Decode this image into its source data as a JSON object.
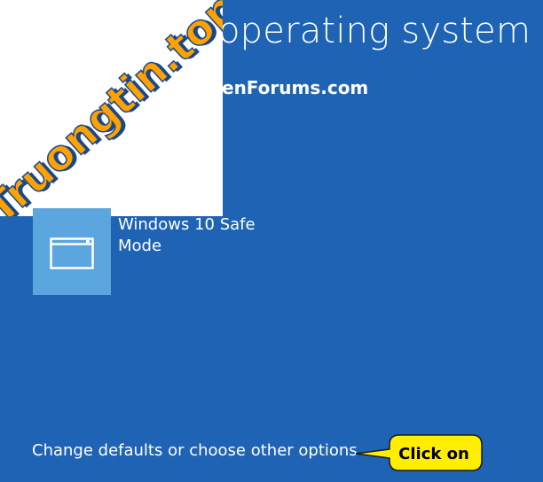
{
  "header": {
    "title": "operating system",
    "site_watermark": "enForums.com"
  },
  "logo": {
    "text": "Truongtin.top",
    "colors": {
      "text": "#ffa200",
      "shadow": "#19488c"
    }
  },
  "options": [
    {
      "label": "Windows 10 Safe Mode",
      "icon": "window-icon"
    }
  ],
  "footer": {
    "change_defaults_label": "Change defaults or choose other options"
  },
  "callout": {
    "text": "Click on",
    "color": "#ffee00"
  },
  "colors": {
    "background": "#1f63b4",
    "tile": "#5ba6de",
    "text": "#ffffff"
  }
}
